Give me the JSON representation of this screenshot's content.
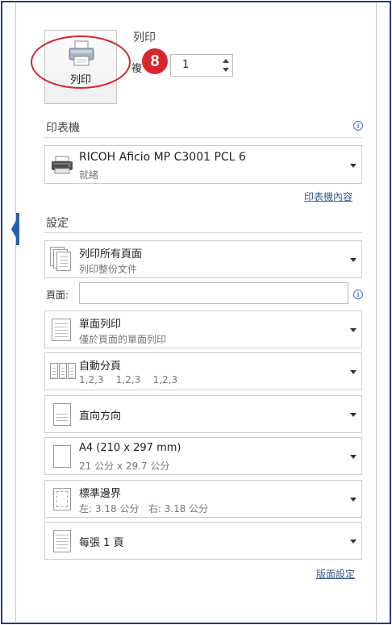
{
  "print": {
    "section_title": "列印",
    "button_label": "列印",
    "copies_label": "複",
    "copies_value": "1",
    "step_number": "8"
  },
  "printer": {
    "section_title": "印表機",
    "name": "RICOH Aficio MP C3001 PCL 6",
    "status": "就緒",
    "properties_link": "印表機內容"
  },
  "settings": {
    "section_title": "設定",
    "pages_label": "頁面:",
    "pages_value": "",
    "items": [
      {
        "title": "列印所有頁面",
        "subtitle": "列印整份文件",
        "icon": "pages-icon"
      },
      {
        "title": "單面列印",
        "subtitle": "僅於頁面的單面列印",
        "icon": "one-sided-icon"
      },
      {
        "title": "自動分頁",
        "subtitle": "1,2,3    1,2,3    1,2,3",
        "icon": "collate-icon"
      },
      {
        "title": "直向方向",
        "subtitle": "",
        "icon": "portrait-icon"
      },
      {
        "title": "A4 (210 x 297 mm)",
        "subtitle": "21 公分 x 29.7 公分",
        "icon": "paper-size-icon"
      },
      {
        "title": "標準邊界",
        "subtitle": "左: 3.18 公分   右: 3.18 公分",
        "icon": "margins-icon"
      },
      {
        "title": "每張 1 頁",
        "subtitle": "",
        "icon": "pages-per-sheet-icon"
      }
    ],
    "page_setup_link": "版面設定"
  }
}
